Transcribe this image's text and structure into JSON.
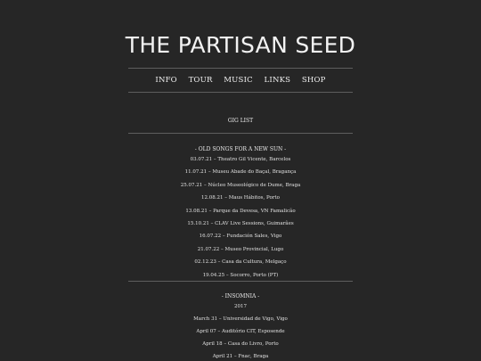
{
  "site": {
    "title": "THE PARTISAN SEED"
  },
  "nav": {
    "items": [
      {
        "label": "INFO"
      },
      {
        "label": "TOUR"
      },
      {
        "label": "MUSIC"
      },
      {
        "label": "LINKS"
      },
      {
        "label": "SHOP"
      }
    ]
  },
  "gig_list": {
    "heading": "GIG LIST"
  },
  "old_songs": {
    "heading": "- OLD SONGS FOR A NEW SUN -",
    "gigs": [
      "03.07.21 – Theatro Gil Vicente, Barcelos",
      "11.07.21 – Museu Abade do Baçal, Bragança",
      "25.07.21 – Núcleo Museológico de Dume, Braga",
      "12.08.21 – Maus Hábitos, Porto",
      "13.08.21 – Parque da Devesa, VN Famalicão",
      "15.10.21 – CLAV Live Sessions, Guimarães",
      "16.07.22 – Fundación Sales, Vigo",
      "21.07.22 – Museo Provincial, Lugo",
      "02.12.23 – Casa da Cultura, Melgaço",
      "19.04.25 – Socorro, Porto (PT)"
    ]
  },
  "insomnia": {
    "heading": "- INSOMNIA -",
    "year": "2017",
    "gigs": [
      "March 31 – Universidad de Vigo, Vigo",
      "April 07 – Auditório CIT, Esposende",
      "April 18 – Casa do Livro, Porto",
      "April 21 – Fnac, Braga"
    ]
  }
}
